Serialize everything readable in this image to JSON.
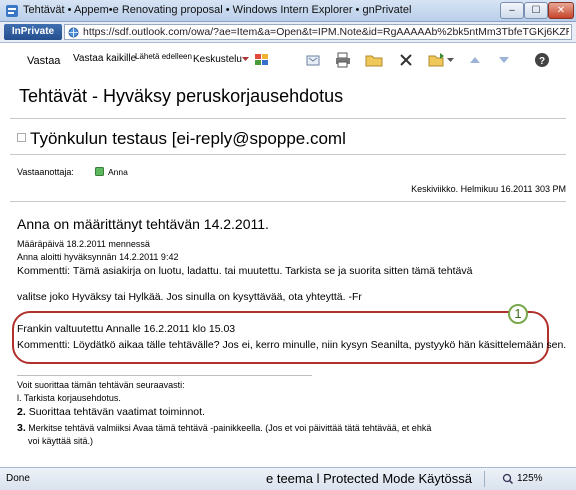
{
  "window": {
    "title": "Tehtävät • Appem•e Renovating proposal • Windows Intern Explorer • gnPrivatel",
    "minimize": "–",
    "maximize": "☐",
    "close": "✕"
  },
  "address": {
    "inprivate": "InPrivate",
    "url": "https://sdf.outlook.com/owa/?ae=Item&a=Open&t=IPM.Note&id=RgAAAAAb%2bk5ntMm3TbfeTGKj6KZRBwDTf1AV"
  },
  "toolbar": {
    "reply": "Vastaa",
    "reply_all": "Vastaa kaikille",
    "forward": "Lähetä edelleen",
    "conversation": "Keskustelu",
    "icons": [
      "chevron-down-icon",
      "category-icon",
      "move-icon",
      "print-icon",
      "folder-icon",
      "delete-icon",
      "move-folder-icon",
      "up-arrow-icon",
      "down-arrow-icon",
      "help-icon"
    ]
  },
  "message": {
    "subject": "Tehtävät - Hyväksy peruskorjausehdotus",
    "from": "Työnkulun testaus [ei-reply@spoppe.coml",
    "to_label": "Vastaanottaja:",
    "to_name": "Anna",
    "date": "Keskiviikko. Helmikuu 16.2011 303 PM",
    "body_heading": "Anna on määrittänyt tehtävän 14.2.2011.",
    "due": "Määräpäivä 18.2.2011 mennessä",
    "started": "Anna aloitti hyväksynnän 14.2.2011 9:42",
    "comment1_a": "Kommentti: Tämä asiakirja on luotu, ladattu. tai muutettu. Tarkista se ja suorita sitten tämä tehtävä",
    "comment1_b": "valitse joko Hyväksy tai Hylkää. Jos sinulla on kysyttävää, ota yhteyttä. -Fr",
    "delegated": "Frankin valtuutettu Annalle 16.2.2011 klo 15.03",
    "comment2": "Kommentti: Löydätkö aikaa tälle tehtävälle? Jos ei, kerro minulle, niin kysyn Seanilta, pystyykö hän käsittelemään sen.",
    "callout_number": "1",
    "steps_intro": "Voit suorittaa tämän tehtävän seuraavasti:",
    "step1": "l. Tarkista korjausehdotus.",
    "step2_num": "2.",
    "step2": "Suorittaa tehtävän vaatimat toiminnot.",
    "step3_num": "3.",
    "step3_a": "Merkitse tehtävä valmiiksi Avaa tämä tehtävä -painikkeella. (Jos et voi päivittää tätä tehtävää, et ehkä",
    "step3_b": "voi käyttää sitä.)"
  },
  "status": {
    "left": "Done",
    "mode": "e teema l Protected Mode Käytössä",
    "zoom": "125%"
  },
  "colors": {
    "accent": "#2d5aa0",
    "callout": "#b0302c",
    "callout_number": "#79a84a"
  }
}
